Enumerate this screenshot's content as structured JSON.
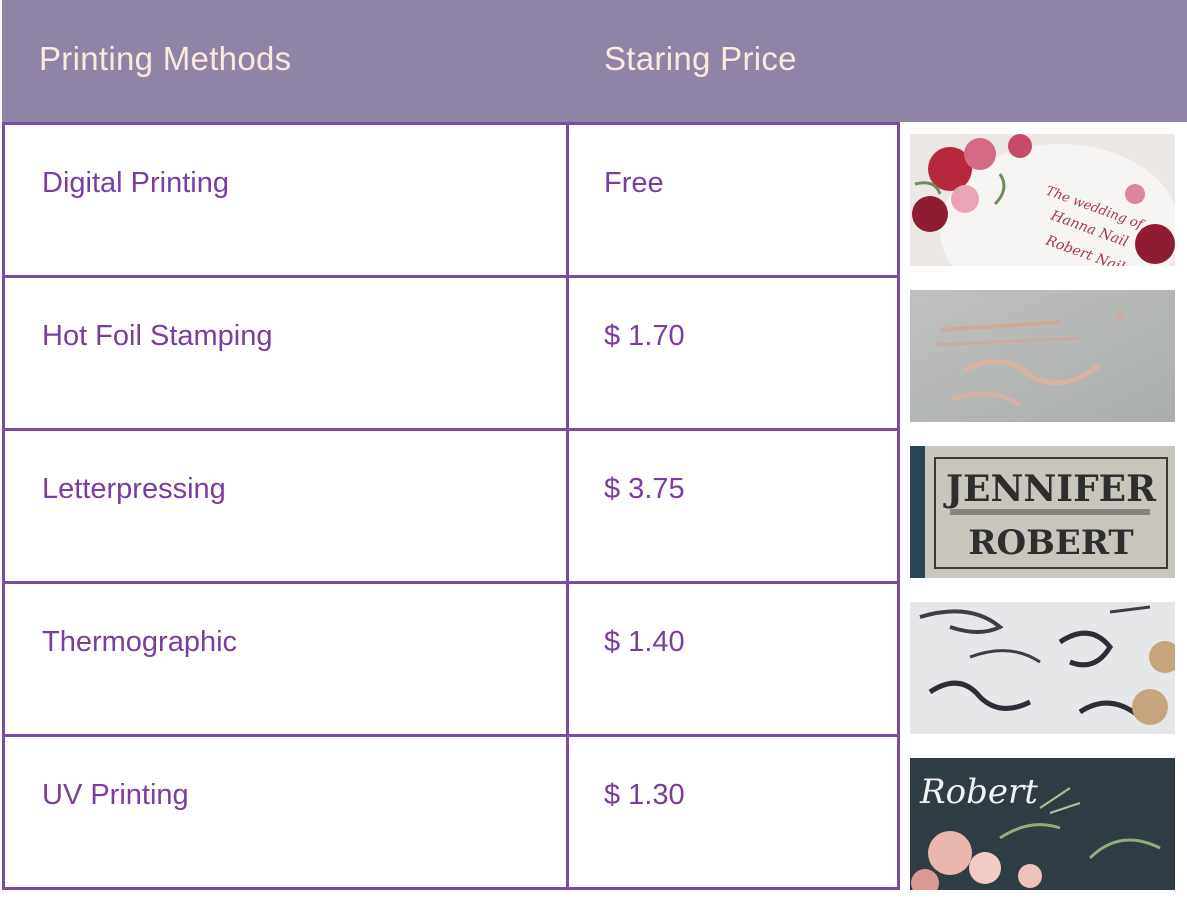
{
  "header": {
    "col_method": "Printing Methods",
    "col_price": "Staring Price"
  },
  "rows": [
    {
      "method": "Digital Printing",
      "price": "Free"
    },
    {
      "method": "Hot  Foil Stamping",
      "price": "$ 1.70"
    },
    {
      "method": "Letterpressing",
      "price": "$ 3.75"
    },
    {
      "method": "Thermographic",
      "price": "$ 1.40"
    },
    {
      "method": "UV Printing",
      "price": "$ 1.30"
    }
  ],
  "images": {
    "letterpress_name_1": "JENNIFER",
    "letterpress_name_2": "ROBERT",
    "uv_name": "Robert"
  },
  "colors": {
    "header_bg": "#9084a6",
    "header_text": "#fbe9dc",
    "border": "#7a4c9f",
    "cell_text": "#7a3e9e"
  }
}
